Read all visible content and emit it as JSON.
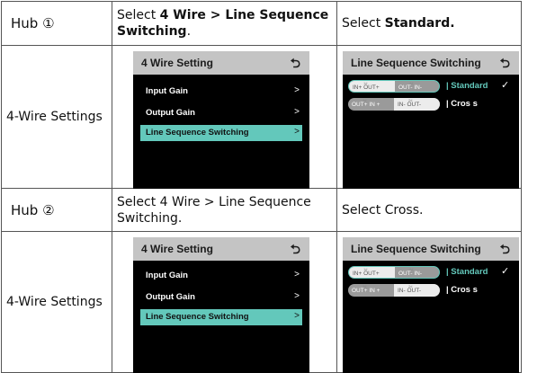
{
  "rows": [
    {
      "type": "hub",
      "label": "Hub ①",
      "instruction": {
        "prefix": "Select ",
        "bold": "4 Wire > Line Sequence Switching",
        "suffix": "."
      },
      "result": {
        "prefix": "Select ",
        "bold": "Standard.",
        "suffix": ""
      }
    },
    {
      "type": "screens",
      "label": "4-Wire Settings",
      "menu": {
        "title": "4 Wire Setting",
        "back_icon": "back-arrow-icon",
        "items": [
          {
            "label": "Input Gain",
            "arrow": ">"
          },
          {
            "label": "Output Gain",
            "arrow": ">"
          },
          {
            "label": "Line Sequence Switching",
            "arrow": ">",
            "selected": true
          }
        ]
      },
      "sequence": {
        "title": "Line Sequence Switching",
        "back_icon": "back-arrow-icon",
        "options": [
          {
            "left_num": "1#",
            "left_text": "IN+   OUT+",
            "right_num": "2#",
            "right_text": "OUT-   IN-",
            "label": "| Standard",
            "active": true,
            "checked": true
          },
          {
            "left_num": "1#",
            "left_text": "OUT+  IN +",
            "right_num": "2#",
            "right_text": "IN-   OUT-",
            "label": "| Cros s",
            "active": false,
            "checked": false
          }
        ]
      }
    },
    {
      "type": "hub",
      "label": "Hub ②",
      "instruction": {
        "prefix": "Select 4 Wire > Line Sequence Switching.",
        "bold": "",
        "suffix": ""
      },
      "result": {
        "prefix": "Select Cross.",
        "bold": "",
        "suffix": ""
      }
    },
    {
      "type": "screens",
      "label": "4-Wire Settings",
      "menu": {
        "title": "4 Wire Setting",
        "back_icon": "back-arrow-icon",
        "items": [
          {
            "label": "Input Gain",
            "arrow": ">"
          },
          {
            "label": "Output Gain",
            "arrow": ">"
          },
          {
            "label": "Line Sequence Switching",
            "arrow": ">",
            "selected": true
          }
        ]
      },
      "sequence": {
        "title": "Line Sequence Switching",
        "back_icon": "back-arrow-icon",
        "options": [
          {
            "left_num": "1#",
            "left_text": "IN+   OUT+",
            "right_num": "2#",
            "right_text": "OUT-   IN-",
            "label": "| Standard",
            "active": true,
            "checked": true
          },
          {
            "left_num": "1#",
            "left_text": "OUT+  IN +",
            "right_num": "2#",
            "right_text": "IN-   OUT-",
            "label": "| Cros s",
            "active": false,
            "checked": false
          }
        ]
      }
    }
  ],
  "colors": {
    "accent": "#63c8bb",
    "header_gray": "#c4c4c4",
    "screen_bg": "#000000"
  },
  "check_mark": "✓"
}
